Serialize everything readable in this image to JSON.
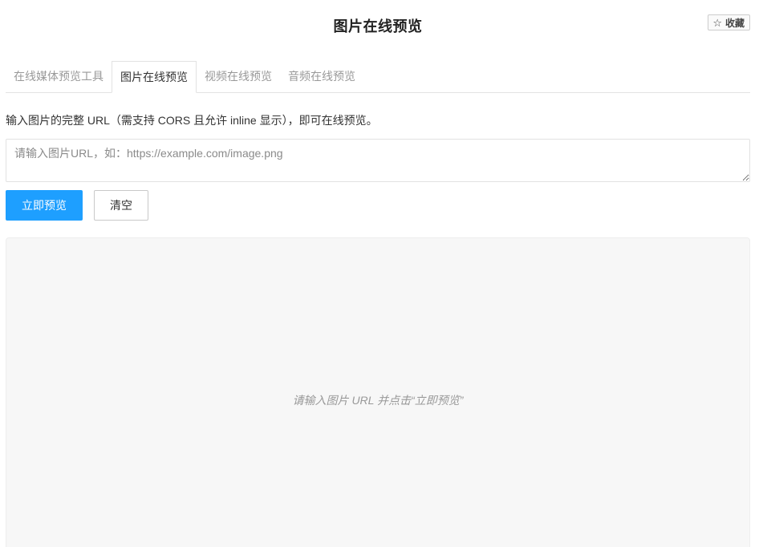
{
  "header": {
    "title": "图片在线预览",
    "favorite_label": "收藏",
    "favorite_icon": "star-outline-icon"
  },
  "tabs": [
    {
      "label": "在线媒体预览工具",
      "active": false
    },
    {
      "label": "图片在线预览",
      "active": true
    },
    {
      "label": "视频在线预览",
      "active": false
    },
    {
      "label": "音频在线预览",
      "active": false
    }
  ],
  "main": {
    "description": "输入图片的完整 URL（需支持 CORS 且允许 inline 显示），即可在线预览。",
    "url_input": {
      "value": "",
      "placeholder": "请输入图片URL，如：https://example.com/image.png"
    },
    "preview_button_label": "立即预览",
    "clear_button_label": "清空",
    "preview_hint": "请输入图片 URL 并点击“立即预览”"
  },
  "colors": {
    "primary": "#1e9fff",
    "preview_bg": "#f7f7f7"
  }
}
